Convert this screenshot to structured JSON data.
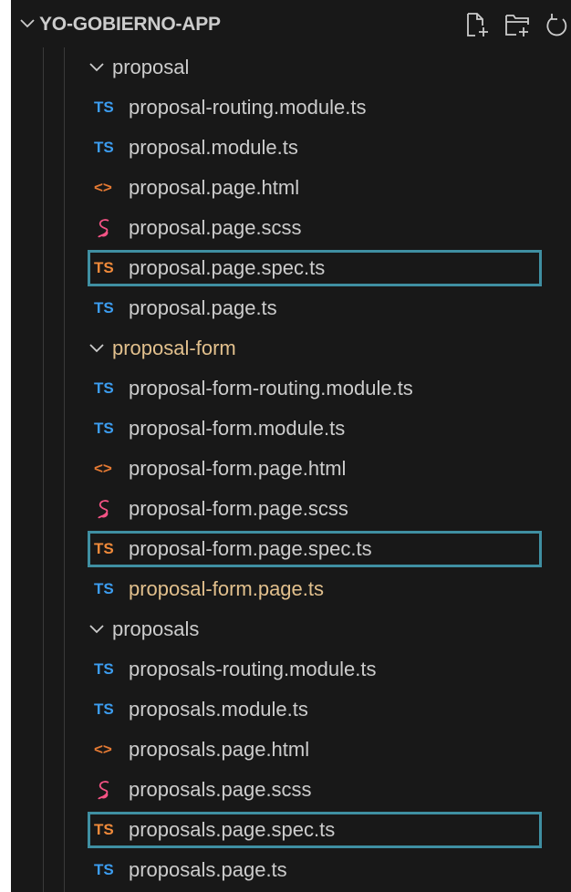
{
  "explorer": {
    "project_title": "YO-GOBIERNO-APP",
    "header_actions": [
      {
        "name": "new-file-icon"
      },
      {
        "name": "new-folder-icon"
      },
      {
        "name": "refresh-icon"
      }
    ]
  },
  "colors": {
    "panel_bg": "#181818",
    "text": "#cccccc",
    "modified_text": "#e2c08d",
    "ts_icon": "#3c9df0",
    "ts_spec_icon": "#f08a3a",
    "html_icon": "#e37933",
    "scss_icon": "#f55385",
    "selection_border": "#3f8fa2"
  },
  "tree": [
    {
      "type": "folder",
      "name": "proposal",
      "expanded": true
    },
    {
      "type": "file",
      "icon": "ts-file-icon",
      "icon_text": "TS",
      "name": "proposal-routing.module.ts"
    },
    {
      "type": "file",
      "icon": "ts-file-icon",
      "icon_text": "TS",
      "name": "proposal.module.ts"
    },
    {
      "type": "file",
      "icon": "html-file-icon",
      "icon_text": "<>",
      "name": "proposal.page.html"
    },
    {
      "type": "file",
      "icon": "scss-file-icon",
      "icon_text": "",
      "name": "proposal.page.scss"
    },
    {
      "type": "file",
      "icon": "ts-spec-file-icon",
      "icon_text": "TS",
      "name": "proposal.page.spec.ts",
      "highlighted": true
    },
    {
      "type": "file",
      "icon": "ts-file-icon",
      "icon_text": "TS",
      "name": "proposal.page.ts"
    },
    {
      "type": "folder",
      "name": "proposal-form",
      "expanded": true,
      "modified": true
    },
    {
      "type": "file",
      "icon": "ts-file-icon",
      "icon_text": "TS",
      "name": "proposal-form-routing.module.ts"
    },
    {
      "type": "file",
      "icon": "ts-file-icon",
      "icon_text": "TS",
      "name": "proposal-form.module.ts"
    },
    {
      "type": "file",
      "icon": "html-file-icon",
      "icon_text": "<>",
      "name": "proposal-form.page.html"
    },
    {
      "type": "file",
      "icon": "scss-file-icon",
      "icon_text": "",
      "name": "proposal-form.page.scss"
    },
    {
      "type": "file",
      "icon": "ts-spec-file-icon",
      "icon_text": "TS",
      "name": "proposal-form.page.spec.ts",
      "highlighted": true
    },
    {
      "type": "file",
      "icon": "ts-file-icon",
      "icon_text": "TS",
      "name": "proposal-form.page.ts",
      "modified": true
    },
    {
      "type": "folder",
      "name": "proposals",
      "expanded": true
    },
    {
      "type": "file",
      "icon": "ts-file-icon",
      "icon_text": "TS",
      "name": "proposals-routing.module.ts"
    },
    {
      "type": "file",
      "icon": "ts-file-icon",
      "icon_text": "TS",
      "name": "proposals.module.ts"
    },
    {
      "type": "file",
      "icon": "html-file-icon",
      "icon_text": "<>",
      "name": "proposals.page.html"
    },
    {
      "type": "file",
      "icon": "scss-file-icon",
      "icon_text": "",
      "name": "proposals.page.scss"
    },
    {
      "type": "file",
      "icon": "ts-spec-file-icon",
      "icon_text": "TS",
      "name": "proposals.page.spec.ts",
      "highlighted": true
    },
    {
      "type": "file",
      "icon": "ts-file-icon",
      "icon_text": "TS",
      "name": "proposals.page.ts"
    }
  ]
}
